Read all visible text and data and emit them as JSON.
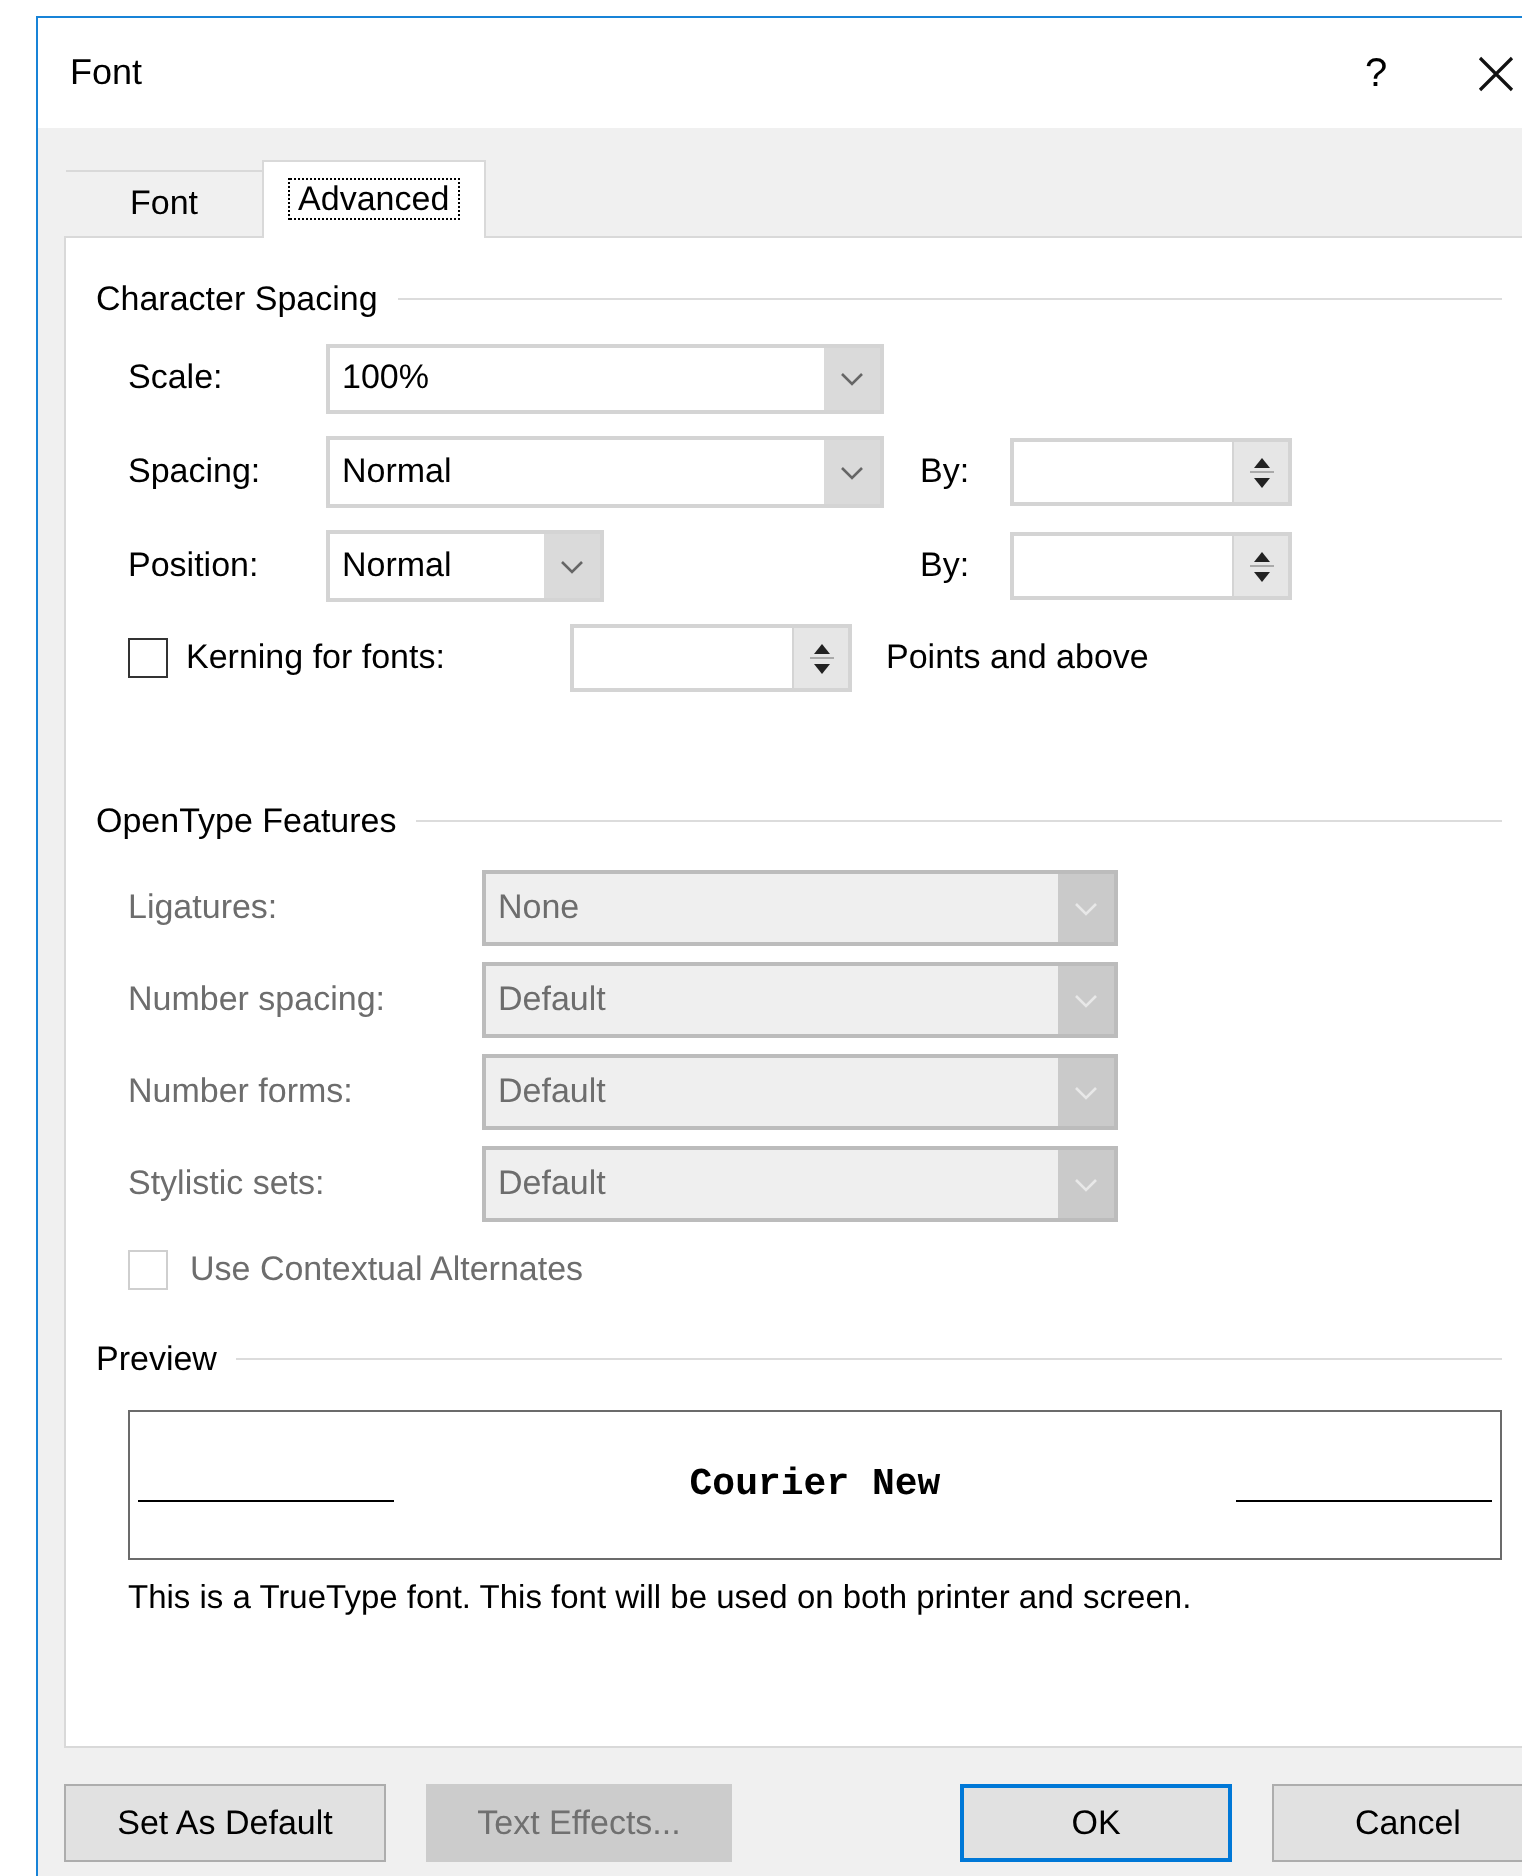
{
  "window": {
    "title": "Font",
    "help": "?"
  },
  "tabs": [
    {
      "label": "Font",
      "selected": false
    },
    {
      "label": "Advanced",
      "selected": true
    }
  ],
  "character_spacing": {
    "heading": "Character Spacing",
    "scale": {
      "label": "Scale:",
      "value": "100%"
    },
    "spacing": {
      "label": "Spacing:",
      "value": "Normal",
      "by_label": "By:"
    },
    "position": {
      "label": "Position:",
      "value": "Normal",
      "by_label": "By:"
    },
    "kerning": {
      "label": "Kerning for fonts:",
      "checked": false,
      "suffix": "Points and above"
    }
  },
  "opentype_features": {
    "heading": "OpenType Features",
    "disabled": true,
    "rows": [
      {
        "label": "Ligatures:",
        "value": "None"
      },
      {
        "label": "Number spacing:",
        "value": "Default"
      },
      {
        "label": "Number forms:",
        "value": "Default"
      },
      {
        "label": "Stylistic sets:",
        "value": "Default"
      }
    ],
    "contextual_alternates": {
      "label": "Use Contextual Alternates",
      "checked": false
    }
  },
  "preview": {
    "heading": "Preview",
    "sample": "Courier New",
    "description": "This is a TrueType font. This font will be used on both printer and screen."
  },
  "buttons": [
    {
      "label": "Set As Default",
      "disabled": false,
      "default": false
    },
    {
      "label": "Text Effects...",
      "disabled": true,
      "default": false
    },
    {
      "label": "OK",
      "disabled": false,
      "default": true
    },
    {
      "label": "Cancel",
      "disabled": false,
      "default": false
    }
  ]
}
